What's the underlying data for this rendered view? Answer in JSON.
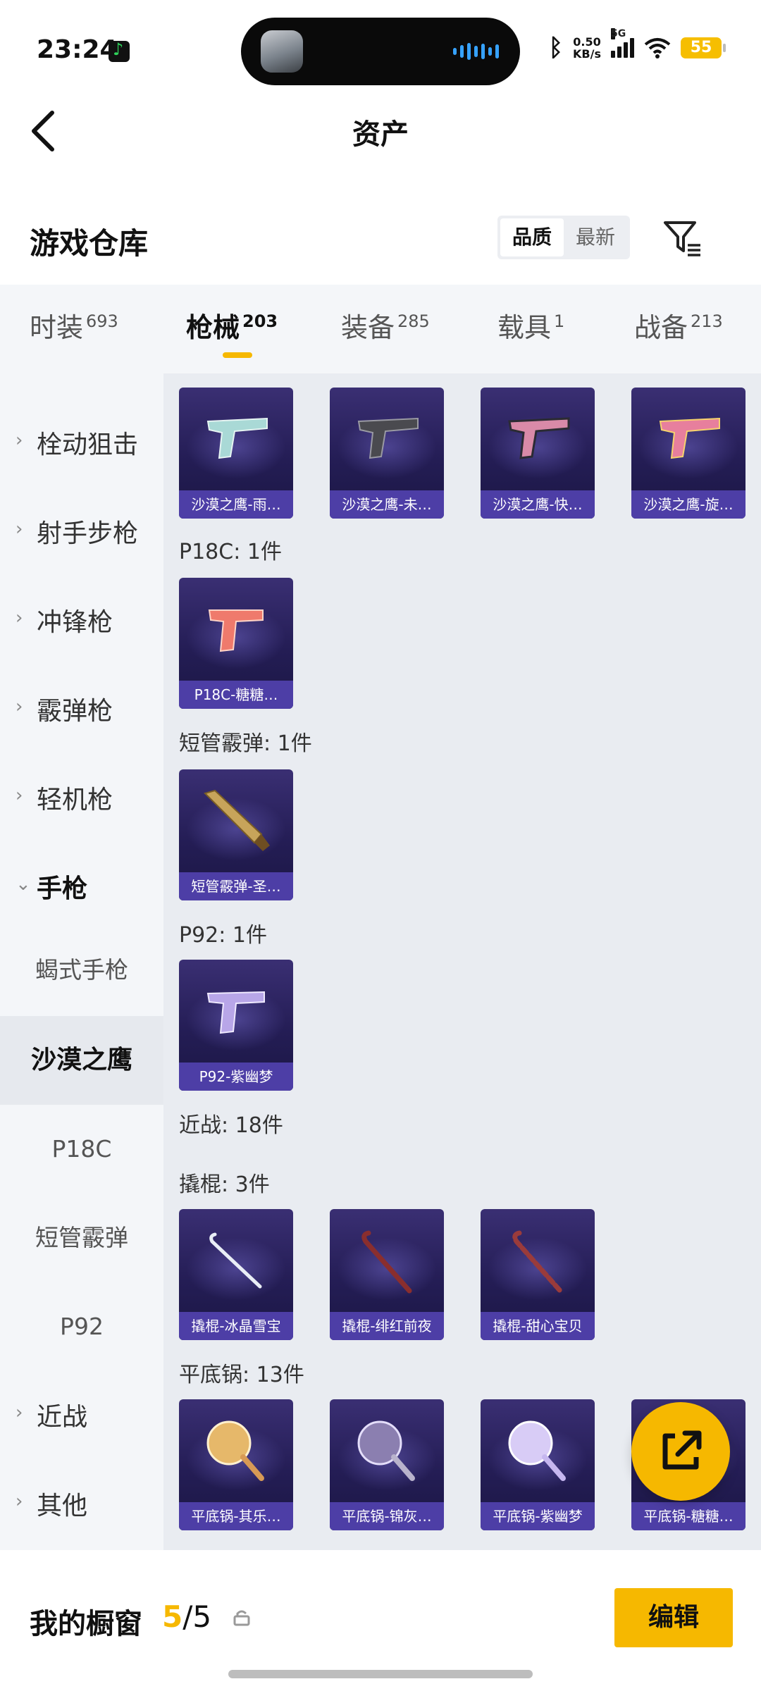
{
  "status_bar": {
    "time": "23:24",
    "net_speed_value": "0.50",
    "net_speed_unit": "KB/s",
    "network": "5G",
    "battery": "55"
  },
  "header": {
    "title": "资产",
    "back_icon": "chevron-left-icon"
  },
  "warehouse": {
    "title": "游戏仓库",
    "sort_options": [
      "品质",
      "最新"
    ],
    "active_sort": "品质",
    "filter_icon": "filter-icon"
  },
  "tabs": [
    {
      "label": "时装",
      "count": "693"
    },
    {
      "label": "枪械",
      "count": "203"
    },
    {
      "label": "装备",
      "count": "285"
    },
    {
      "label": "载具",
      "count": "1"
    },
    {
      "label": "战备",
      "count": "213"
    }
  ],
  "active_tab": "枪械",
  "sidebar": {
    "categories": [
      "栓动狙击",
      "射手步枪",
      "冲锋枪",
      "霰弹枪",
      "轻机枪",
      "手枪"
    ],
    "pistol_sub": [
      "蝎式手枪",
      "沙漠之鹰",
      "P18C",
      "短管霰弹",
      "P92"
    ],
    "selected_sub": "沙漠之鹰",
    "more_categories": [
      "近战",
      "其他"
    ]
  },
  "content": {
    "deagle_cards": [
      "沙漠之鹰-雨…",
      "沙漠之鹰-未…",
      "沙漠之鹰-快…",
      "沙漠之鹰-旋…"
    ],
    "p18c_header": "P18C: 1件",
    "p18c_cards": [
      "P18C-糖糖…"
    ],
    "shortshotgun_header": "短管霰弹: 1件",
    "shortshotgun_cards": [
      "短管霰弹-圣…"
    ],
    "p92_header": "P92: 1件",
    "p92_cards": [
      "P92-紫幽梦"
    ],
    "melee_header": "近战: 18件",
    "crowbar_header": "撬棍: 3件",
    "crowbar_cards": [
      "撬棍-冰晶雪宝",
      "撬棍-绯红前夜",
      "撬棍-甜心宝贝"
    ],
    "pan_header": "平底锅: 13件",
    "pan_cards": [
      "平底锅-其乐…",
      "平底锅-锦灰…",
      "平底锅-紫幽梦",
      "平底锅-糖糖…"
    ]
  },
  "colors": {
    "accent": "#f6b800",
    "card_bg": "#2a2260",
    "caption_bg": "#4d3ea6"
  },
  "fab_icon": "share-external-icon",
  "bottom": {
    "label": "我的橱窗",
    "current": "5",
    "separator": "/",
    "total": "5",
    "lock_icon": "lock-icon",
    "edit_label": "编辑"
  }
}
